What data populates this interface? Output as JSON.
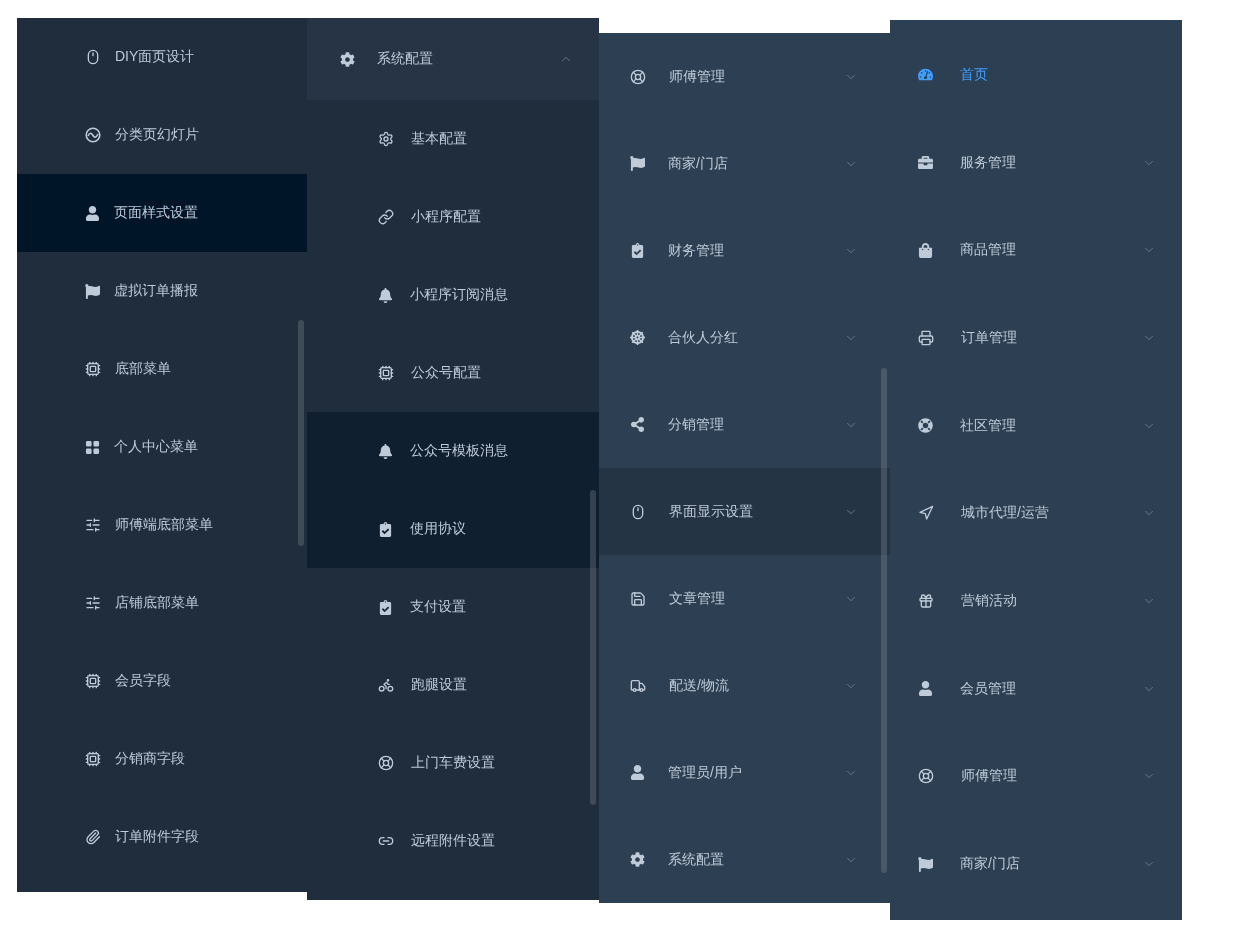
{
  "menus": [
    {
      "items": [
        {
          "label": "DIY面页设计",
          "selected": false
        },
        {
          "label": "分类页幻灯片",
          "selected": false
        },
        {
          "label": "页面样式设置",
          "selected": true
        },
        {
          "label": "虚拟订单播报",
          "selected": false
        },
        {
          "label": "底部菜单",
          "selected": false
        },
        {
          "label": "个人中心菜单",
          "selected": false
        },
        {
          "label": "师傅端底部菜单",
          "selected": false
        },
        {
          "label": "店铺底部菜单",
          "selected": false
        },
        {
          "label": "会员字段",
          "selected": false
        },
        {
          "label": "分销商字段",
          "selected": false
        },
        {
          "label": "订单附件字段",
          "selected": false
        }
      ]
    },
    {
      "header": {
        "label": "系统配置",
        "expanded": true
      },
      "items": [
        {
          "label": "基本配置",
          "selected": false
        },
        {
          "label": "小程序配置",
          "selected": false
        },
        {
          "label": "小程序订阅消息",
          "selected": false
        },
        {
          "label": "公众号配置",
          "selected": false
        },
        {
          "label": "公众号模板消息",
          "selected": true
        },
        {
          "label": "使用协议",
          "selected": true
        },
        {
          "label": "支付设置",
          "selected": false
        },
        {
          "label": "跑腿设置",
          "selected": false
        },
        {
          "label": "上门车费设置",
          "selected": false
        },
        {
          "label": "远程附件设置",
          "selected": false
        }
      ]
    },
    {
      "items": [
        {
          "label": "师傅管理",
          "selected": false,
          "expanded": false
        },
        {
          "label": "商家/门店",
          "selected": false,
          "expanded": false
        },
        {
          "label": "财务管理",
          "selected": false,
          "expanded": false
        },
        {
          "label": "合伙人分红",
          "selected": false,
          "expanded": false
        },
        {
          "label": "分销管理",
          "selected": false,
          "expanded": false
        },
        {
          "label": "界面显示设置",
          "selected": true,
          "expanded": false
        },
        {
          "label": "文章管理",
          "selected": false,
          "expanded": false
        },
        {
          "label": "配送/物流",
          "selected": false,
          "expanded": false
        },
        {
          "label": "管理员/用户",
          "selected": false,
          "expanded": false
        },
        {
          "label": "系统配置",
          "selected": false,
          "expanded": false
        }
      ]
    },
    {
      "items": [
        {
          "label": "首页",
          "selected": true
        },
        {
          "label": "服务管理",
          "selected": false,
          "expanded": false
        },
        {
          "label": "商品管理",
          "selected": false,
          "expanded": false
        },
        {
          "label": "订单管理",
          "selected": false,
          "expanded": false
        },
        {
          "label": "社区管理",
          "selected": false,
          "expanded": false
        },
        {
          "label": "城市代理/运营",
          "selected": false,
          "expanded": false
        },
        {
          "label": "营销活动",
          "selected": false,
          "expanded": false
        },
        {
          "label": "会员管理",
          "selected": false,
          "expanded": false
        },
        {
          "label": "师傅管理",
          "selected": false,
          "expanded": false
        },
        {
          "label": "商家/门店",
          "selected": false,
          "expanded": false
        }
      ]
    }
  ]
}
